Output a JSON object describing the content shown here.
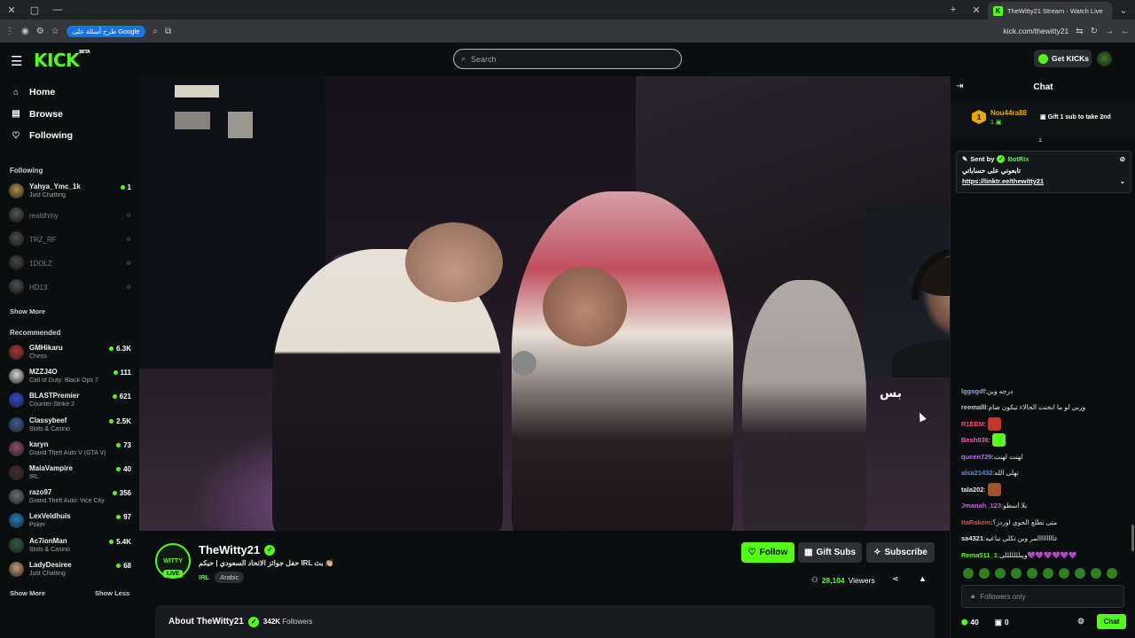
{
  "browser": {
    "tab_title": "TheWitty21 Stream - Watch Live",
    "google_pill": "طرح أسئلة على Google",
    "url": "kick.com/thewitty21"
  },
  "nav": {
    "logo": "KICK",
    "logo_badge": "BETA",
    "search_placeholder": "Search",
    "get_kicks_label": "Get KICKs"
  },
  "sidebar": {
    "links": [
      {
        "label": "Home",
        "icon": "home-icon"
      },
      {
        "label": "Browse",
        "icon": "browse-icon"
      },
      {
        "label": "Following",
        "icon": "heart-icon"
      }
    ],
    "following_heading": "Following",
    "following": [
      {
        "name": "Yahya_Ymc_1k",
        "category": "Just Chatting",
        "viewers": "1",
        "live": true,
        "color": "#b08a4a"
      },
      {
        "name": "realdhmy",
        "live": false,
        "color": "#9aa0a4"
      },
      {
        "name": "TRZ_RF",
        "live": false,
        "color": "#8a8f93"
      },
      {
        "name": "1DOLZ",
        "live": false,
        "color": "#7f8488"
      },
      {
        "name": "HD13",
        "live": false,
        "color": "#8e9397"
      }
    ],
    "show_more_following": "Show More",
    "recommended_heading": "Recommended",
    "recommended": [
      {
        "name": "GMHikaru",
        "category": "Chess",
        "viewers": "6.3K",
        "color": "#b2322d"
      },
      {
        "name": "MZZJ4O",
        "category": "Call of Duty: Black Ops 7",
        "viewers": "111",
        "color": "#d9d9d9"
      },
      {
        "name": "BLASTPremier",
        "category": "Counter-Strike 2",
        "viewers": "621",
        "color": "#2b4bd6"
      },
      {
        "name": "Classybeef",
        "category": "Slots & Casino",
        "viewers": "2.5K",
        "color": "#3a5d9c"
      },
      {
        "name": "karyn",
        "category": "Grand Theft Auto V (GTA V)",
        "viewers": "73",
        "color": "#8e4c6a"
      },
      {
        "name": "MaiaVampire",
        "category": "IRL",
        "viewers": "40",
        "color": "#4a2a2a"
      },
      {
        "name": "razo97",
        "category": "Grand Theft Auto: Vice City",
        "viewers": "356",
        "color": "#6a6f74"
      },
      {
        "name": "LexVeldhuis",
        "category": "Poker",
        "viewers": "97",
        "color": "#1d7ec2"
      },
      {
        "name": "Ac7ionMan",
        "category": "Slots & Casino",
        "viewers": "5.4K",
        "color": "#2d5d3c"
      },
      {
        "name": "LadyDesiree",
        "category": "Just Chatting",
        "viewers": "68",
        "color": "#c99a7a"
      }
    ],
    "show_more_recommended": "Show More",
    "show_less": "Show Less"
  },
  "video": {
    "overlay_text": "بس"
  },
  "channel": {
    "name": "TheWitty21",
    "avatar_text": "WITTY",
    "live_badge": "LIVE",
    "stream_title": "حفل جوائز الاتحاد السعودي | حيكم IRL بث 👏🏼",
    "category": "IRL",
    "language_tag": "Arabic",
    "follow_label": "Follow",
    "gift_subs_label": "Gift Subs",
    "subscribe_label": "Subscribe",
    "viewers_count": "28,104",
    "viewers_label": "Viewers",
    "about_title": "About TheWitty21",
    "followers_count": "342K",
    "followers_label": "Followers"
  },
  "chat": {
    "title": "Chat",
    "top_gifter": {
      "rank": "1",
      "name": "Nou44ra88",
      "count": "1",
      "cta": "Gift 1 sub to take 2nd"
    },
    "pinned": {
      "sent_by_label": "Sent by",
      "bot_name": "BotRix",
      "text": "تابعوني على حساباتي",
      "link": "https://linktr.ee/thewitty21"
    },
    "messages": [
      {
        "user": "lggsgdf",
        "text": "درجه وين",
        "color": "#8fa7d6"
      },
      {
        "user": "reemalll",
        "text": "وربي لو ما انحنت الجالاء تبكون ضام",
        "color": "#c9c9c9"
      },
      {
        "user": "R1EEM",
        "text": "",
        "color": "#e7546c",
        "emote": "#c0392b"
      },
      {
        "user": "Besh036",
        "text": "",
        "color": "#e75fb0",
        "emote": "#53fc18"
      },
      {
        "user": "queen729",
        "text": "لهنت لهنت",
        "color": "#b86cf0"
      },
      {
        "user": "alsa21432",
        "text": "نهلى الله",
        "color": "#5a8be8"
      },
      {
        "user": "tala202",
        "text": "",
        "color": "#e6e6e6",
        "emote": "#a0522d"
      },
      {
        "user": "Jmanah_123",
        "text": "بلا اسطو",
        "color": "#c260e0"
      },
      {
        "user": "ItaRakem",
        "text": "متى تطلع الجوي اوردز؟",
        "color": "#e74c3c"
      },
      {
        "user": "sa4321",
        "text": "عاااااااالمر وين تكلي تباعيه",
        "color": "#e6e6e6"
      },
      {
        "user": "Rema511_1",
        "text": "ويبلللللللى💜💜💜💜💜💜",
        "color": "#53fc18"
      }
    ],
    "followers_only_label": "Followers only",
    "kicks_points": "40",
    "gift_count": "0",
    "send_label": "Chat"
  },
  "colors": {
    "accent": "#53fc18",
    "background": "#0b0e0f",
    "panel": "#191b1f"
  }
}
